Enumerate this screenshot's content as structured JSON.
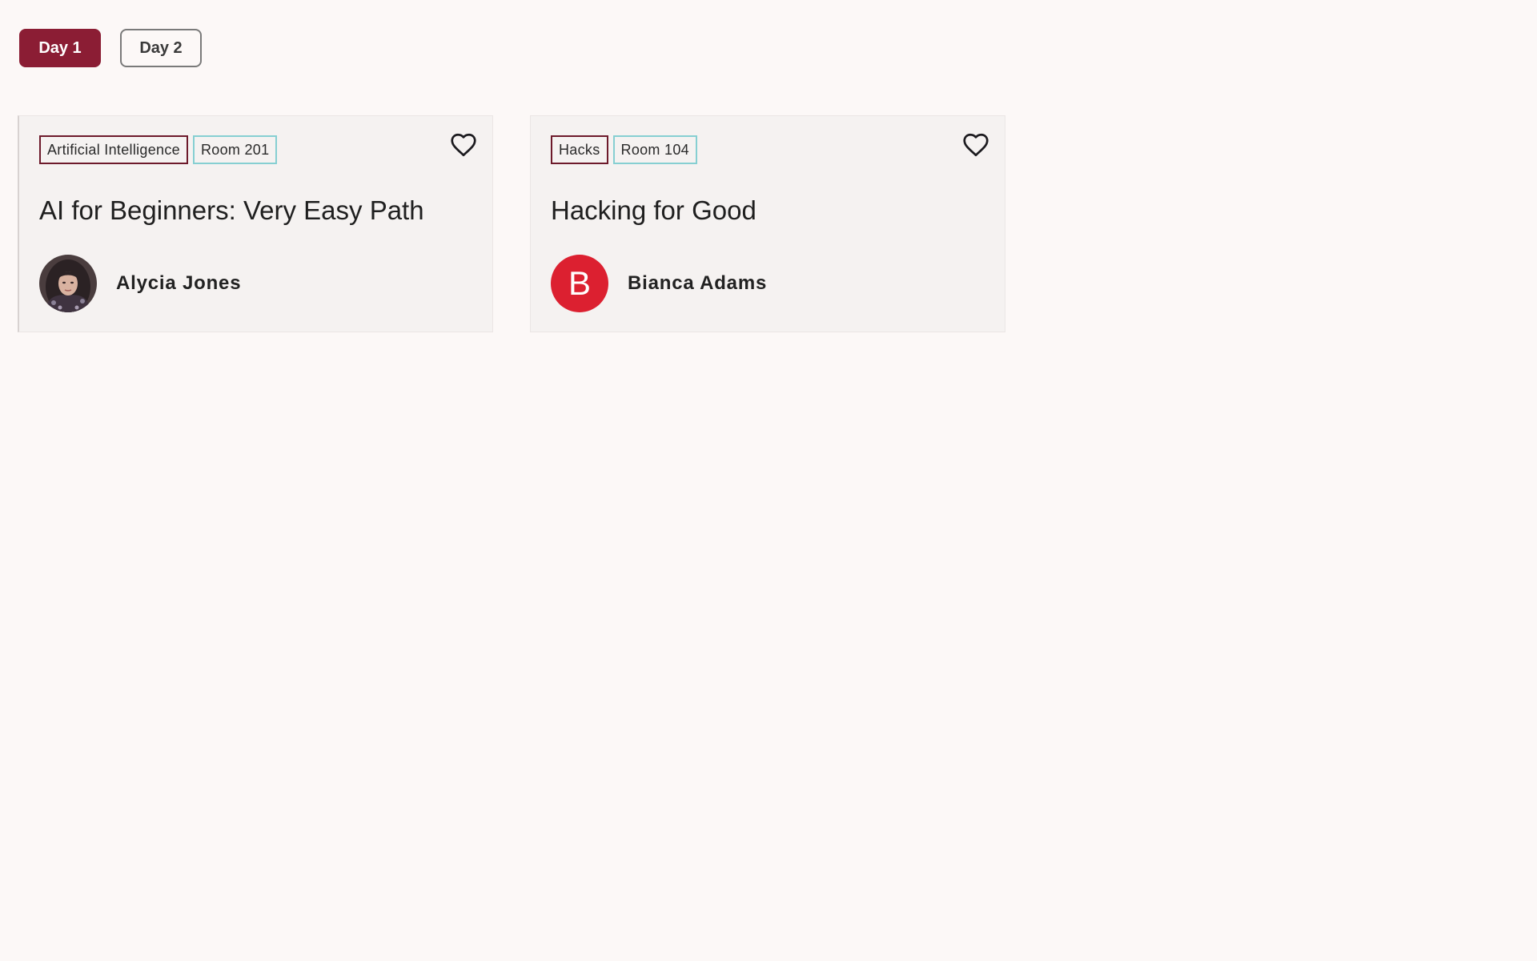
{
  "day_tabs": [
    {
      "label": "Day 1",
      "selected": true
    },
    {
      "label": "Day 2",
      "selected": false
    }
  ],
  "sessions": [
    {
      "topic_tag": "Artificial Intelligence",
      "room_tag": "Room 201",
      "title": "AI for Beginners: Very Easy Path",
      "speaker": {
        "name": "Alycia Jones",
        "avatar": "photo"
      },
      "favorite_icon": "heart-outline-icon"
    },
    {
      "topic_tag": "Hacks",
      "room_tag": "Room 104",
      "title": "Hacking for Good",
      "speaker": {
        "name": "Bianca Adams",
        "avatar": "letter",
        "avatar_letter": "B",
        "avatar_color": "#dc2030"
      },
      "favorite_icon": "heart-outline-icon"
    }
  ],
  "colors": {
    "accent": "#8b1d34",
    "topic_tag_border": "#6d1a2b",
    "room_tag_border": "#86cfd2",
    "background": "#fcf8f7",
    "card_background": "#f5f2f1"
  }
}
